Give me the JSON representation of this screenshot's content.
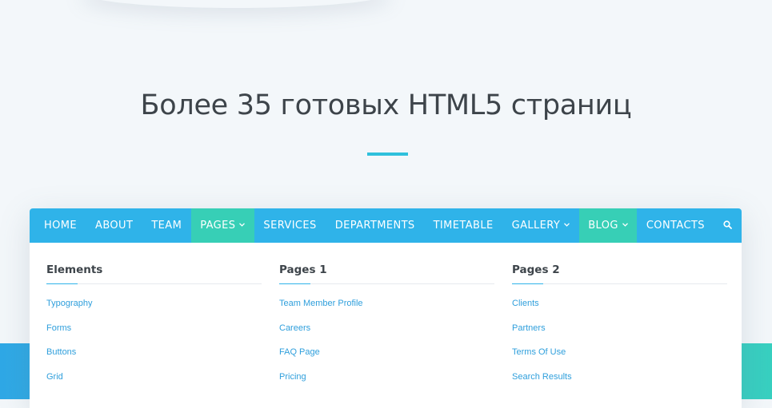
{
  "headline": "Более 35 готовых HTML5 страниц",
  "colors": {
    "nav_bg": "#2fb3e9",
    "nav_active": "#37cfb6",
    "link": "#2f9fdc",
    "accent": "#2fc0dc",
    "heading": "#3d444a"
  },
  "nav": {
    "items": [
      {
        "label": "HOME"
      },
      {
        "label": "ABOUT"
      },
      {
        "label": "TEAM"
      },
      {
        "label": "PAGES",
        "has_dropdown": true,
        "active": true
      },
      {
        "label": "SERVICES"
      },
      {
        "label": "DEPARTMENTS"
      },
      {
        "label": "TIMETABLE"
      },
      {
        "label": "GALLERY",
        "has_dropdown": true
      },
      {
        "label": "BLOG",
        "has_dropdown": true,
        "active": true
      },
      {
        "label": "CONTACTS"
      }
    ],
    "search_icon": "search-icon"
  },
  "mega_menu": {
    "columns": [
      {
        "title": "Elements",
        "links": [
          "Typography",
          "Forms",
          "Buttons",
          "Grid"
        ]
      },
      {
        "title": "Pages 1",
        "links": [
          "Team Member Profile",
          "Careers",
          "FAQ Page",
          "Pricing"
        ]
      },
      {
        "title": "Pages 2",
        "links": [
          "Clients",
          "Partners",
          "Terms Of Use",
          "Search Results"
        ]
      }
    ]
  }
}
